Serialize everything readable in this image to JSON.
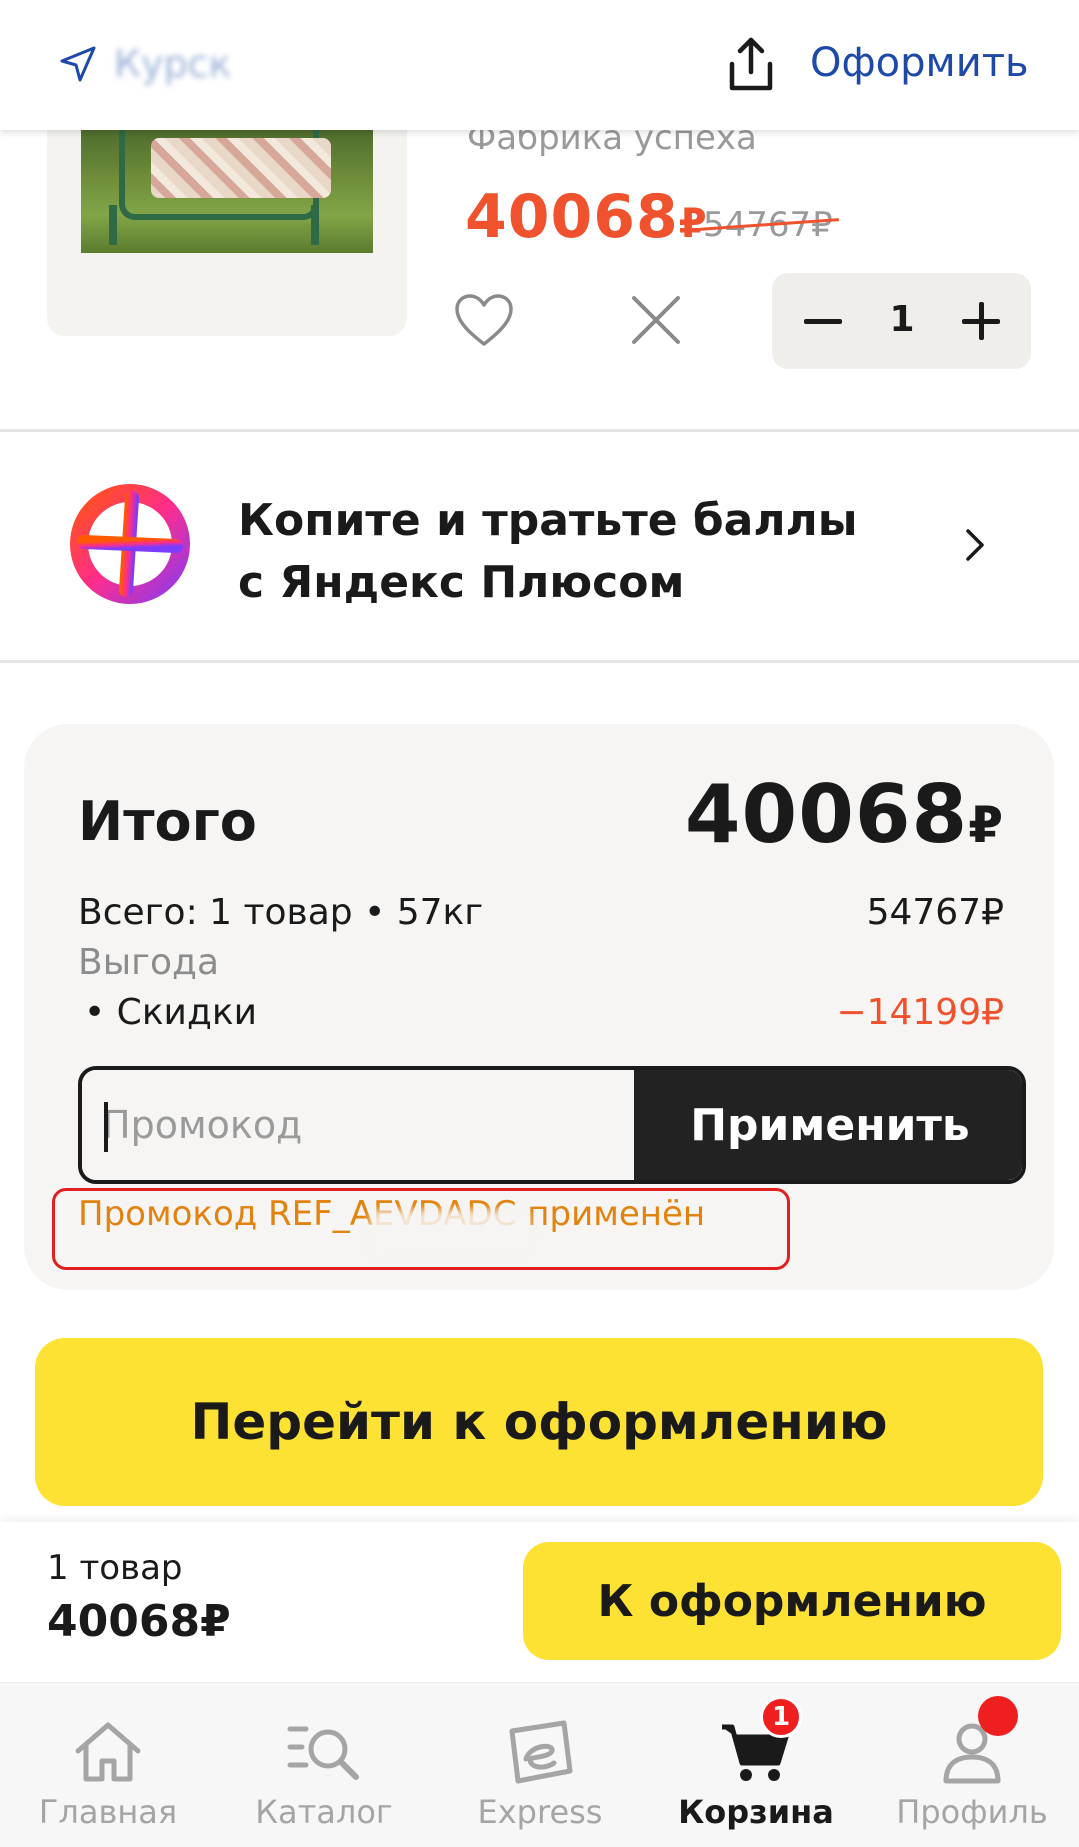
{
  "header": {
    "city": "Курск",
    "checkout_label": "Оформить"
  },
  "product": {
    "brand": "Фабрика успеха",
    "price": "40068",
    "currency": "₽",
    "old_price": "54767₽",
    "quantity": "1"
  },
  "plus_banner": {
    "line1": "Копите и тратьте баллы",
    "line2": "с Яндекс Плюсом"
  },
  "summary": {
    "title": "Итого",
    "total": "40068",
    "currency": "₽",
    "items_label": "Всего: 1 товар • 57кг",
    "items_value": "54767₽",
    "benefit_label": "Выгода",
    "discount_label": "• Скидки",
    "discount_value": "−14199₽",
    "promo_placeholder": "Промокод",
    "promo_button": "Применить",
    "promo_message": "Промокод REF_AEVDADC применён"
  },
  "cta": {
    "label": "Перейти к оформлению"
  },
  "sticky_bar": {
    "count": "1 товар",
    "price": "40068₽",
    "button": "К оформлению"
  },
  "tabbar": {
    "tabs": [
      {
        "label": "Главная",
        "icon": "home-icon"
      },
      {
        "label": "Каталог",
        "icon": "catalog-search-icon"
      },
      {
        "label": "Express",
        "icon": "express-icon"
      },
      {
        "label": "Корзина",
        "icon": "cart-icon",
        "active": true
      },
      {
        "label": "Профиль",
        "icon": "profile-icon"
      }
    ],
    "cart_badge": "1"
  },
  "colors": {
    "accent_yellow": "#fde133",
    "price_red": "#f0522d",
    "link_blue": "#1d4aa8",
    "promo_orange": "#e2830f"
  }
}
